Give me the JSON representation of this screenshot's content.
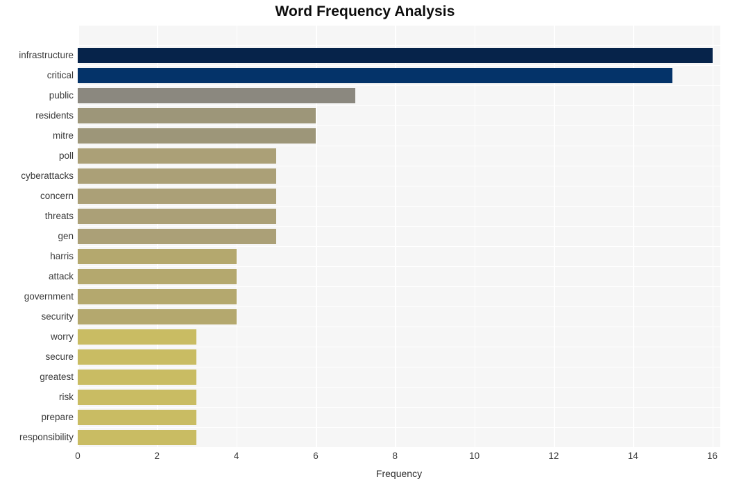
{
  "chart_data": {
    "type": "bar",
    "orientation": "horizontal",
    "title": "Word Frequency Analysis",
    "xlabel": "Frequency",
    "ylabel": "",
    "xlim": [
      0,
      16.2
    ],
    "xticks": [
      0,
      2,
      4,
      6,
      8,
      10,
      12,
      14,
      16
    ],
    "xticklabels": [
      "0",
      "2",
      "4",
      "6",
      "8",
      "10",
      "12",
      "14",
      "16"
    ],
    "grid": "vertical-white-on-light-gray",
    "legend": "none",
    "categories": [
      "infrastructure",
      "critical",
      "public",
      "residents",
      "mitre",
      "poll",
      "cyberattacks",
      "concern",
      "threats",
      "gen",
      "harris",
      "attack",
      "government",
      "security",
      "worry",
      "secure",
      "greatest",
      "risk",
      "prepare",
      "responsibility"
    ],
    "values": [
      16,
      15,
      7,
      6,
      6,
      5,
      5,
      5,
      5,
      5,
      4,
      4,
      4,
      4,
      3,
      3,
      3,
      3,
      3,
      3
    ],
    "bar_colors": [
      "#06234a",
      "#043369",
      "#8b887f",
      "#9d9679",
      "#9d9679",
      "#aba077",
      "#aba077",
      "#aba077",
      "#aba077",
      "#aba077",
      "#b4a86e",
      "#b4a86e",
      "#b4a86e",
      "#b4a86e",
      "#c9bc63",
      "#c9bc63",
      "#c9bc63",
      "#c9bc63",
      "#c9bc63",
      "#c9bc63"
    ]
  },
  "style": {
    "figure_background": "#ffffff",
    "plot_background": "#f6f6f6",
    "gridline_color": "#ffffff",
    "title_color": "#0d0d0d",
    "tick_label_color": "#3a3a3a"
  }
}
